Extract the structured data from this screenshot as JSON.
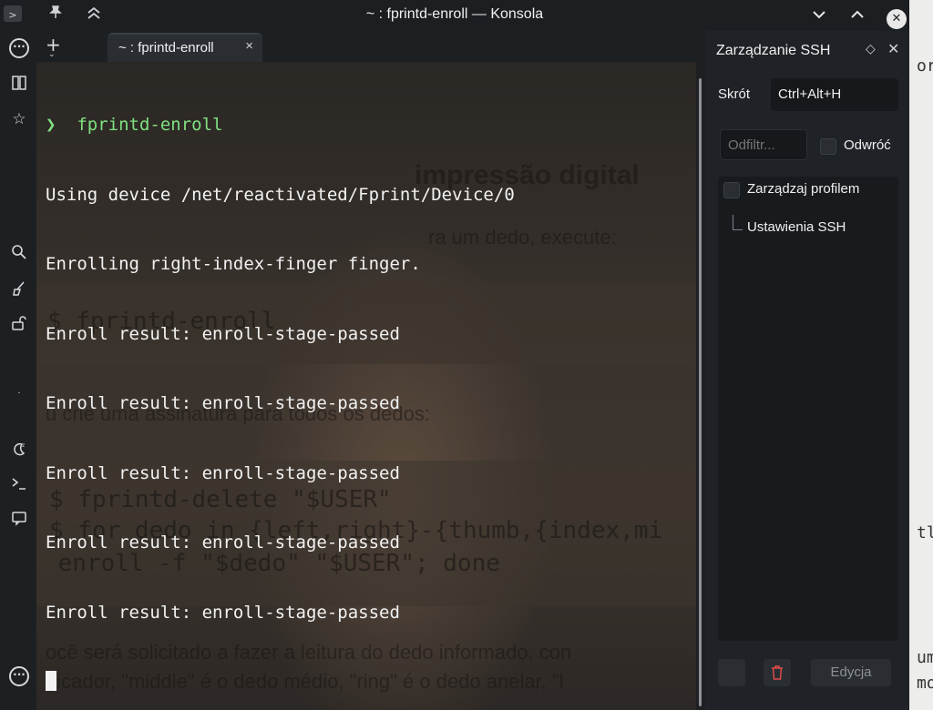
{
  "window": {
    "title": "~ : fprintd-enroll — Konsola"
  },
  "tab": {
    "label": "~ : fprintd-enroll",
    "close": "×",
    "new": "+"
  },
  "terminal": {
    "prompt_symbol": "❯",
    "command": "fprintd-enroll",
    "output": [
      "Using device /net/reactivated/Fprint/Device/0",
      "Enrolling right-index-finger finger.",
      "Enroll result: enroll-stage-passed",
      "Enroll result: enroll-stage-passed",
      "Enroll result: enroll-stage-passed",
      "Enroll result: enroll-stage-passed",
      "Enroll result: enroll-stage-passed"
    ]
  },
  "background_text": {
    "heading": "impressão digital",
    "line1": "ra um dedo, execute:",
    "code1": "$ fprintd-enroll",
    "line2": "u crie uma assinatura para todos os dedos:",
    "code2a": "$ fprintd-delete \"$USER\"",
    "code2b": "$ for dedo in {left,right}-{thumb,{index,mi",
    "code2c": " enroll -f \"$dedo\" \"$USER\"; done",
    "line3": "ocê será solicitado a fazer a leitura do dedo informado, con",
    "line4": "dicador, \"middle\" é o dedo médio, \"ring\" é o dedo anelar, \"l",
    "right_edge": [
      "or",
      "tle",
      "um",
      "mo"
    ]
  },
  "ssh_panel": {
    "title": "Zarządzanie SSH",
    "shortcut_label": "Skrót",
    "shortcut_value": "Ctrl+Alt+H",
    "filter_placeholder": "Odfiltr...",
    "invert_label": "Odwróć",
    "manage_profile_label": "Zarządzaj profilem",
    "tree_item": "Ustawienia SSH",
    "edit_button": "Edycja"
  },
  "icons": {
    "pin": "pin-icon",
    "keep_above": "chevrons-up-icon",
    "minimize": "chevron-down-icon",
    "maximize": "chevron-up-icon",
    "close": "close-icon",
    "delete": "trash-icon"
  }
}
